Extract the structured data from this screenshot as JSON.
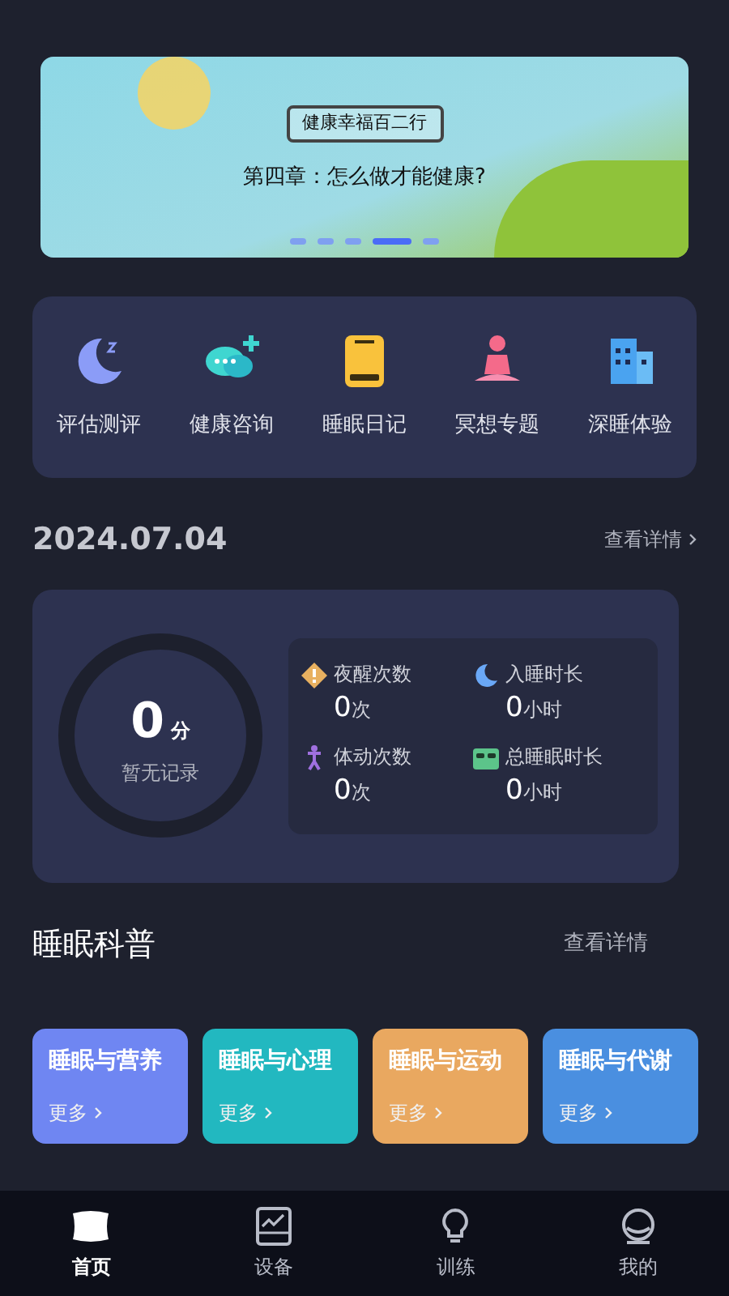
{
  "banner": {
    "tag": "健康幸福百二行",
    "title": "第四章：怎么做才能健康?",
    "dots": [
      {
        "selected": false
      },
      {
        "selected": false
      },
      {
        "selected": false
      },
      {
        "selected": true
      },
      {
        "selected": false
      }
    ]
  },
  "quick_menu": [
    {
      "kind": "moon",
      "label": "评估测评"
    },
    {
      "kind": "chat",
      "label": "健康咨询"
    },
    {
      "kind": "book",
      "label": "睡眠日记"
    },
    {
      "kind": "meditate",
      "label": "冥想专题"
    },
    {
      "kind": "building",
      "label": "深睡体验"
    }
  ],
  "report": {
    "date": "2024.07.04",
    "link": "查看详情",
    "score": "0",
    "score_unit": "分",
    "score_note": "暂无记录",
    "stats": [
      {
        "kind": "warning",
        "label": "夜醒次数",
        "value": "0",
        "unit": "次"
      },
      {
        "kind": "moon",
        "label": "入睡时长",
        "value": "0",
        "unit": "小时"
      },
      {
        "kind": "move",
        "label": "体动次数",
        "value": "0",
        "unit": "次"
      },
      {
        "kind": "bed",
        "label": "总睡眠时长",
        "value": "0",
        "unit": "小时"
      }
    ]
  },
  "science": {
    "title": "睡眠科普",
    "link": "查看详情",
    "cards": [
      {
        "title": "睡眠与营养",
        "more": "更多",
        "color": "#6f86f2"
      },
      {
        "title": "睡眠与心理",
        "more": "更多",
        "color": "#22b8c0"
      },
      {
        "title": "睡眠与运动",
        "more": "更多",
        "color": "#e9a860"
      },
      {
        "title": "睡眠与代谢",
        "more": "更多",
        "color": "#4a8fe0"
      }
    ]
  },
  "tab_bar": [
    {
      "kind": "home",
      "label": "首页",
      "selected": true
    },
    {
      "kind": "device",
      "label": "设备",
      "selected": false
    },
    {
      "kind": "train",
      "label": "训练",
      "selected": false
    },
    {
      "kind": "me",
      "label": "我的",
      "selected": false
    }
  ]
}
